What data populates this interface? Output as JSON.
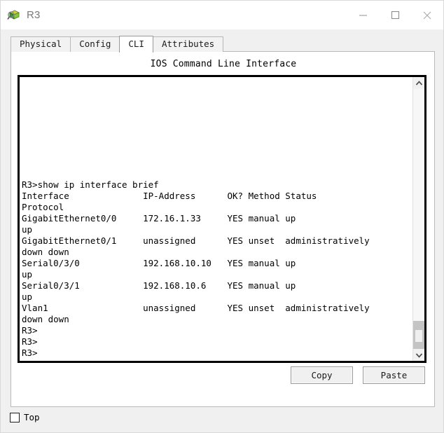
{
  "window": {
    "title": "R3",
    "icon": "router-device-icon",
    "controls": {
      "minimize": "minimize-icon",
      "maximize": "maximize-icon",
      "close": "close-icon"
    }
  },
  "tabs": [
    {
      "label": "Physical",
      "active": false
    },
    {
      "label": "Config",
      "active": false
    },
    {
      "label": "CLI",
      "active": true
    },
    {
      "label": "Attributes",
      "active": false
    }
  ],
  "panel": {
    "heading": "IOS Command Line Interface"
  },
  "terminal": {
    "content": "R3>show ip interface brief\nInterface              IP-Address      OK? Method Status\nProtocol\nGigabitEthernet0/0     172.16.1.33     YES manual up\nup\nGigabitEthernet0/1     unassigned      YES unset  administratively\ndown down\nSerial0/3/0            192.168.10.10   YES manual up\nup\nSerial0/3/1            192.168.10.6    YES manual up\nup\nVlan1                  unassigned      YES unset  administratively\ndown down\nR3>\nR3>\nR3>",
    "prompt": "R3>",
    "command": "show ip interface brief",
    "table": {
      "headers": [
        "Interface",
        "IP-Address",
        "OK?",
        "Method",
        "Status",
        "Protocol"
      ],
      "rows": [
        [
          "GigabitEthernet0/0",
          "172.16.1.33",
          "YES",
          "manual",
          "up",
          "up"
        ],
        [
          "GigabitEthernet0/1",
          "unassigned",
          "YES",
          "unset",
          "administratively down",
          "down"
        ],
        [
          "Serial0/3/0",
          "192.168.10.10",
          "YES",
          "manual",
          "up",
          "up"
        ],
        [
          "Serial0/3/1",
          "192.168.10.6",
          "YES",
          "manual",
          "up",
          "up"
        ],
        [
          "Vlan1",
          "unassigned",
          "YES",
          "unset",
          "administratively down",
          "down"
        ]
      ]
    },
    "scrollbar": {
      "up_arrow": "chevron-up-icon",
      "down_arrow": "chevron-down-icon"
    }
  },
  "buttons": {
    "copy": "Copy",
    "paste": "Paste"
  },
  "footer": {
    "top_checkbox_label": "Top",
    "top_checked": false
  },
  "colors": {
    "window_bg": "#f0f0f0",
    "panel_bg": "#ffffff",
    "terminal_border": "#000000",
    "tab_inactive": "#f2f2f2",
    "tab_active": "#ffffff",
    "title_text": "#7a7a7a",
    "scroll_thumb": "#c4c4c4"
  }
}
